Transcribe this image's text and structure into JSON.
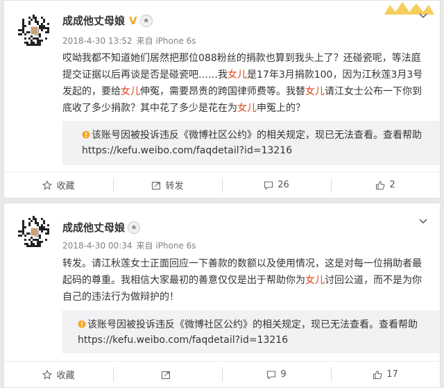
{
  "posts": [
    {
      "author": "成成他丈母娘",
      "verified_badge": "V",
      "date": "2018-4-30 13:52",
      "source": "来自 iPhone 6s",
      "text": [
        {
          "t": "哎呦我都不知道她们居然把那位088粉丝的捐款也算到我头上了？还碰瓷呢，等法庭提交证据以后再谈是否是碰瓷吧……我",
          "red": false
        },
        {
          "t": "女儿",
          "red": true
        },
        {
          "t": "是17年3月捐款100，因为江秋莲3月3号发起的，要给",
          "red": false
        },
        {
          "t": "女儿",
          "red": true
        },
        {
          "t": "伸冤，需要昂贵的跨国律师费等。我替",
          "red": false
        },
        {
          "t": "女儿",
          "red": true
        },
        {
          "t": "请江女士公布一下你到底收了多少捐款？其中花了多少是花在为",
          "red": false
        },
        {
          "t": "女儿",
          "red": true
        },
        {
          "t": "申冤上的？",
          "red": false
        }
      ],
      "notice": "该账号因被投诉违反《微博社区公约》的相关规定，现已无法查看。查看帮助",
      "notice_url": "https://kefu.weibo.com/faqdetail?id=13216",
      "actions": {
        "favorite": "收藏",
        "repost": "转发",
        "comments": "26",
        "likes": "2"
      }
    },
    {
      "author": "成成他丈母娘",
      "verified_badge": "",
      "date": "2018-4-30 00:34",
      "source": "来自 iPhone 6s",
      "text": [
        {
          "t": "转发。请江秋莲女士正面回应一下善款的数额以及使用情况，这是对每一位捐助者最起码的尊重。我相信大家最初的善意仅仅是出于帮助你为",
          "red": false
        },
        {
          "t": "女儿",
          "red": true
        },
        {
          "t": "讨回公道，而不是为你自己的违法行为做辩护的！",
          "red": false
        }
      ],
      "notice": "该账号因被投诉违反《微博社区公约》的相关规定，现已无法查看。查看帮助",
      "notice_url": "https://kefu.weibo.com/faqdetail?id=13216",
      "actions": {
        "favorite": "收藏",
        "repost": "",
        "comments": "9",
        "likes": "17"
      }
    }
  ],
  "colors": {
    "highlight": "#e0421b",
    "badge": "#f5a623",
    "notice_bg": "#f2f2f5"
  },
  "icons": [
    "qr-avatar",
    "verified-v-icon",
    "medal-icon",
    "chevron-down-icon",
    "notice-icon",
    "star-icon",
    "repost-icon",
    "comment-icon",
    "like-icon",
    "crown-ornament-icon"
  ]
}
